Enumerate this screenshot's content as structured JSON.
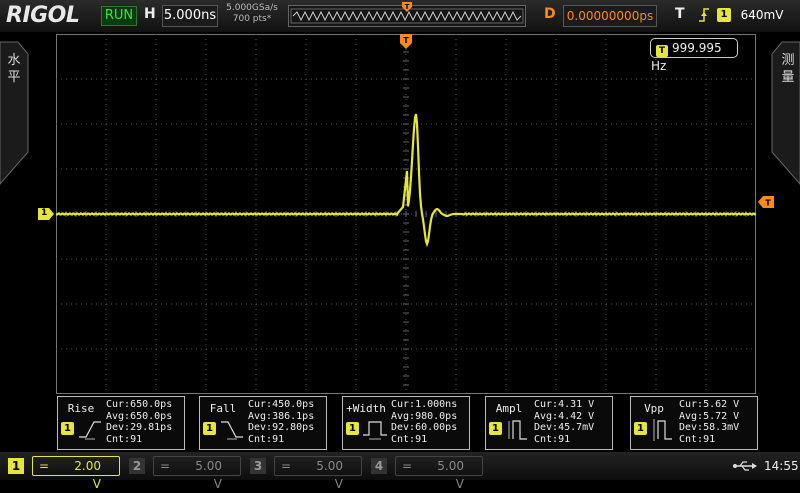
{
  "header": {
    "brand": "RIGOL",
    "run_status": "RUN",
    "horizontal_label": "H",
    "timebase": "5.000ns",
    "sample_rate": "5.000GSa/s",
    "memory_depth": "700 pts*",
    "delay_label": "D",
    "delay_value": "0.00000000ps",
    "trigger_label": "T",
    "trigger_channel": "1",
    "trigger_level": "640mV"
  },
  "side": {
    "left_tab": "水平",
    "right_tab": "测量"
  },
  "display": {
    "frequency_counter_icon": "T",
    "frequency": "999.995 Hz",
    "ch1_marker": "1",
    "trigger_marker": "T",
    "trace_color": "#e6e63a"
  },
  "measurements": [
    {
      "name": "Rise",
      "channel": "1",
      "icon": "rise-edge-icon",
      "cur": "Cur:650.0ps",
      "avg": "Avg:650.0ps",
      "dev": "Dev:29.81ps",
      "cnt": "Cnt:91"
    },
    {
      "name": "Fall",
      "channel": "1",
      "icon": "fall-edge-icon",
      "cur": "Cur:450.0ps",
      "avg": "Avg:386.1ps",
      "dev": "Dev:92.80ps",
      "cnt": "Cnt:91"
    },
    {
      "name": "+Width",
      "channel": "1",
      "icon": "positive-width-icon",
      "cur": "Cur:1.000ns",
      "avg": "Avg:980.0ps",
      "dev": "Dev:60.00ps",
      "cnt": "Cnt:91"
    },
    {
      "name": "Ampl",
      "channel": "1",
      "icon": "amplitude-icon",
      "cur": "Cur:4.31 V",
      "avg": "Avg:4.42 V",
      "dev": "Dev:45.7mV",
      "cnt": "Cnt:91"
    },
    {
      "name": "Vpp",
      "channel": "1",
      "icon": "vpp-icon",
      "cur": "Cur:5.62 V",
      "avg": "Avg:5.72 V",
      "dev": "Dev:58.3mV",
      "cnt": "Cnt:91"
    }
  ],
  "channels": [
    {
      "number": "1",
      "coupling": "=",
      "scale": "2.00 V",
      "active": true,
      "color": "#e6e63a"
    },
    {
      "number": "2",
      "coupling": "=",
      "scale": "5.00 V",
      "active": false,
      "color": "#888888"
    },
    {
      "number": "3",
      "coupling": "=",
      "scale": "5.00 V",
      "active": false,
      "color": "#888888"
    },
    {
      "number": "4",
      "coupling": "=",
      "scale": "5.00 V",
      "active": false,
      "color": "#888888"
    }
  ],
  "status": {
    "usb_icon": "usb-icon",
    "time": "14:55"
  }
}
